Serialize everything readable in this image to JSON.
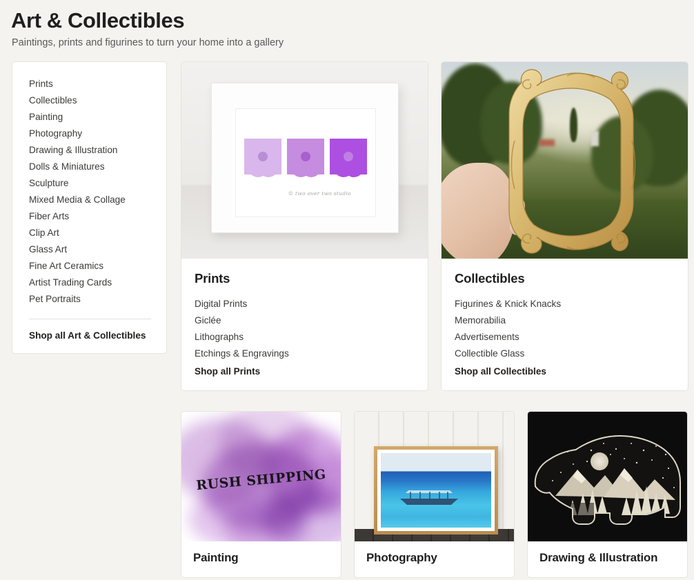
{
  "header": {
    "title": "Art & Collectibles",
    "subtitle": "Paintings, prints and figurines to turn your home into a gallery"
  },
  "sidebar": {
    "items": [
      {
        "label": "Prints"
      },
      {
        "label": "Collectibles"
      },
      {
        "label": "Painting"
      },
      {
        "label": "Photography"
      },
      {
        "label": "Drawing & Illustration"
      },
      {
        "label": "Dolls & Miniatures"
      },
      {
        "label": "Sculpture"
      },
      {
        "label": "Mixed Media & Collage"
      },
      {
        "label": "Fiber Arts"
      },
      {
        "label": "Clip Art"
      },
      {
        "label": "Glass Art"
      },
      {
        "label": "Fine Art Ceramics"
      },
      {
        "label": "Artist Trading Cards"
      },
      {
        "label": "Pet Portraits"
      }
    ],
    "shop_all": "Shop all Art & Collectibles"
  },
  "cards": {
    "prints": {
      "title": "Prints",
      "subcategories": [
        "Digital Prints",
        "Giclée",
        "Lithographs",
        "Etchings & Engravings"
      ],
      "shop_all": "Shop all Prints",
      "image_alt": "framed print of three purple flowers",
      "watermark": "© two over two studio"
    },
    "collectibles": {
      "title": "Collectibles",
      "subcategories": [
        "Figurines & Knick Knacks",
        "Memorabilia",
        "Advertisements",
        "Collectible Glass"
      ],
      "shop_all": "Shop all Collectibles",
      "image_alt": "hand holding ornate gold picture frame outdoors"
    },
    "painting": {
      "title": "Painting",
      "image_alt": "purple watercolor wash",
      "image_text": "RUSH SHIPPING"
    },
    "photography": {
      "title": "Photography",
      "image_alt": "framed photograph of a boat on turquoise water"
    },
    "drawing": {
      "title": "Drawing & Illustration",
      "image_alt": "bear silhouette with mountain and forest night scene"
    }
  },
  "colors": {
    "page_background": "#f4f3ef",
    "card_background": "#ffffff",
    "card_border": "#e6e4de",
    "title_text": "#1f1f1f",
    "subtitle_text": "#595959",
    "link_text": "#3a3a38",
    "bold_link_text": "#22201e",
    "accent_purple": "#b777cf",
    "accent_gold": "#c49a5c",
    "accent_blue": "#2a79c9"
  }
}
